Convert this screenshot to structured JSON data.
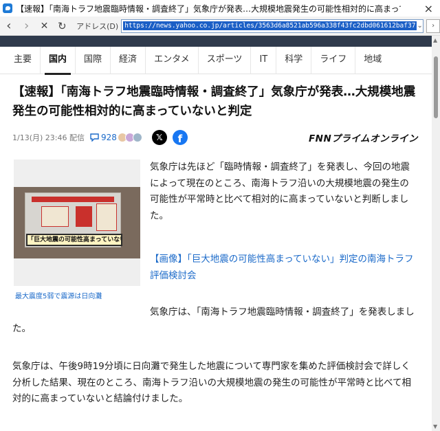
{
  "window": {
    "title": "【速報】「南海トラフ地震臨時情報・調査終了」気象庁が発表…大規模地震発生の可能性相対的に高まってい",
    "close_glyph": "×"
  },
  "toolbar": {
    "back": "‹",
    "forward": "›",
    "stop": "✕",
    "reload": "↻",
    "address_label": "アドレス(D)",
    "url": "https://news.yahoo.co.jp/articles/3563d6a8521ab596a338f43fc2dbd061612baf37",
    "dropdown": "⌄",
    "extra": "›"
  },
  "categories": [
    "主要",
    "国内",
    "国際",
    "経済",
    "エンタメ",
    "スポーツ",
    "IT",
    "科学",
    "ライフ",
    "地域"
  ],
  "active_category": "国内",
  "article": {
    "headline": "【速報】「南海トラフ地震臨時情報・調査終了」気象庁が発表…大規模地震発生の可能性相対的に高まっていないと判定",
    "date": "1/13(月) 23:46 配信",
    "comment_count": "928",
    "source": "FNNプライムオンライン",
    "image_overlay": "「巨大地震の可能性高まっていない」",
    "image_caption": "最大震度5弱で震源は日向灘",
    "lead": "気象庁は先ほど「臨時情報・調査終了」を発表し、今回の地震によって現在のところ、南海トラフ沿いの大規模地震の発生の可能性が平常時と比べて相対的に高まっていないと判断しました。",
    "image_link": "【画像】「巨大地震の可能性高まっていない」判定の南海トラフ評価検討会",
    "para2": "気象庁は、「南海トラフ地震臨時情報・調査終了」を発表しました。",
    "para3": "気象庁は、午後9時19分頃に日向灘で発生した地震について専門家を集めた評価検討会で詳しく分析した結果、現在のところ、南海トラフ沿いの大規模地震の発生の可能性が平常時と比べて相対的に高まっていないと結論付けました。"
  },
  "colors": {
    "link": "#1b6ac9",
    "facebook": "#1877f2",
    "x": "#000000",
    "nav_dark": "#2f3a4c"
  }
}
